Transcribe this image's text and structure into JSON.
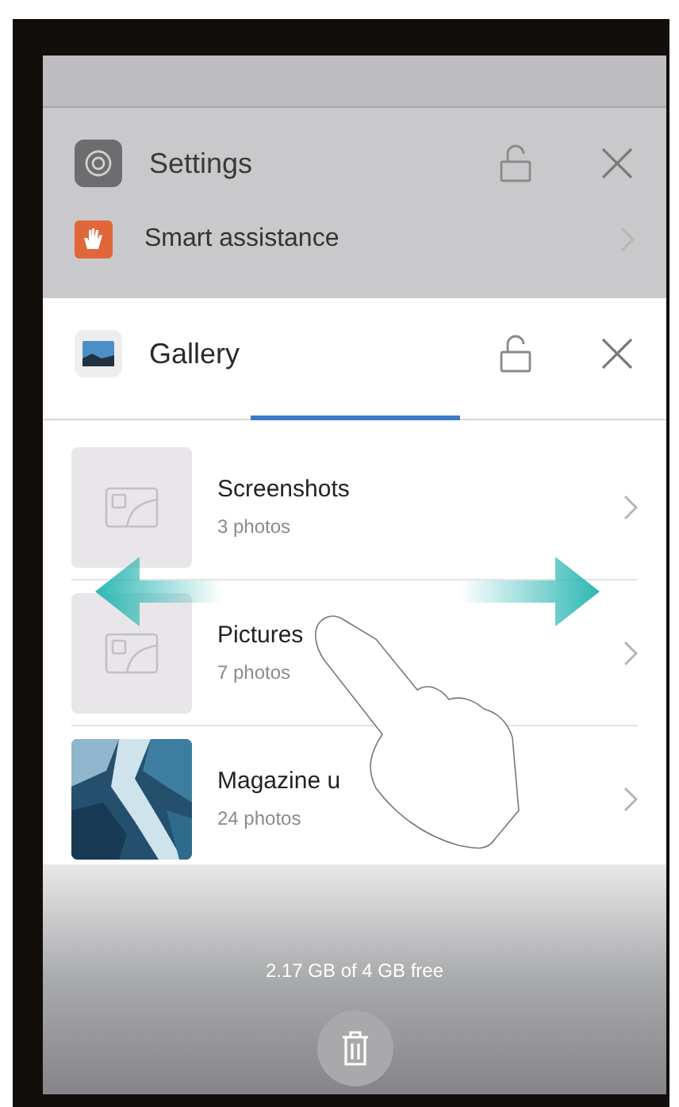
{
  "settings_card": {
    "title": "Settings",
    "row": {
      "label": "Smart assistance"
    }
  },
  "gallery_card": {
    "title": "Gallery",
    "albums": [
      {
        "name": "Screenshots",
        "count": "3 photos",
        "kind": "placeholder"
      },
      {
        "name": "Pictures",
        "count": "7 photos",
        "kind": "placeholder"
      },
      {
        "name": "Magazine u",
        "count": "24 photos",
        "kind": "picture"
      }
    ]
  },
  "storage": "2.17 GB of 4 GB free"
}
